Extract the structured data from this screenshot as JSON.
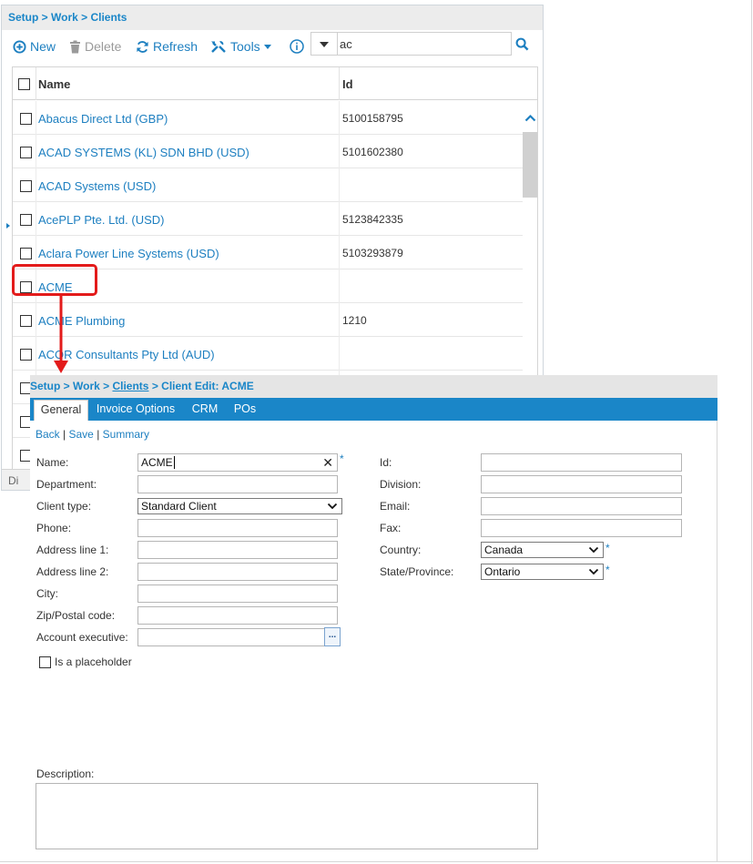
{
  "list": {
    "breadcrumb": "Setup > Work > Clients",
    "toolbar": {
      "new_label": "New",
      "delete_label": "Delete",
      "refresh_label": "Refresh",
      "tools_label": "Tools"
    },
    "search": {
      "value": "ac"
    },
    "columns": {
      "name": "Name",
      "id": "Id"
    },
    "rows": [
      {
        "name": "Abacus Direct Ltd (GBP)",
        "id": "5100158795"
      },
      {
        "name": "ACAD SYSTEMS (KL) SDN BHD (USD)",
        "id": "5101602380"
      },
      {
        "name": "ACAD Systems (USD)",
        "id": ""
      },
      {
        "name": "AcePLP Pte. Ltd. (USD)",
        "id": "5123842335"
      },
      {
        "name": "Aclara Power Line Systems (USD)",
        "id": "5103293879"
      },
      {
        "name": "ACME",
        "id": ""
      },
      {
        "name": "ACME Plumbing",
        "id": "1210"
      },
      {
        "name": "ACOR Consultants Pty Ltd (AUD)",
        "id": ""
      },
      {
        "name": "",
        "id": ""
      },
      {
        "name": "",
        "id": ""
      },
      {
        "name": "",
        "id": ""
      }
    ],
    "footer_text": "Di"
  },
  "edit": {
    "breadcrumb": {
      "part1": "Setup > Work > ",
      "clients_link": "Clients",
      "part2": " > Client Edit: ACME"
    },
    "tabs": [
      "General",
      "Invoice Options",
      "CRM",
      "POs"
    ],
    "actions": {
      "back": "Back",
      "save": "Save",
      "summary": "Summary",
      "sep": "|"
    },
    "fields": {
      "name_label": "Name:",
      "name_value": "ACME",
      "department_label": "Department:",
      "client_type_label": "Client type:",
      "client_type_value": "Standard Client",
      "phone_label": "Phone:",
      "address1_label": "Address line 1:",
      "address2_label": "Address line 2:",
      "city_label": "City:",
      "zip_label": "Zip/Postal code:",
      "account_exec_label": "Account executive:",
      "account_exec_button": "...",
      "placeholder_label": "Is a placeholder",
      "id_label": "Id:",
      "division_label": "Division:",
      "email_label": "Email:",
      "fax_label": "Fax:",
      "country_label": "Country:",
      "country_value": "Canada",
      "state_label": "State/Province:",
      "state_value": "Ontario",
      "description_label": "Description:",
      "required_mark": "*"
    }
  },
  "colors": {
    "accent": "#1a86c8",
    "link": "#1d7fc0",
    "highlight": "#e31b1b"
  }
}
